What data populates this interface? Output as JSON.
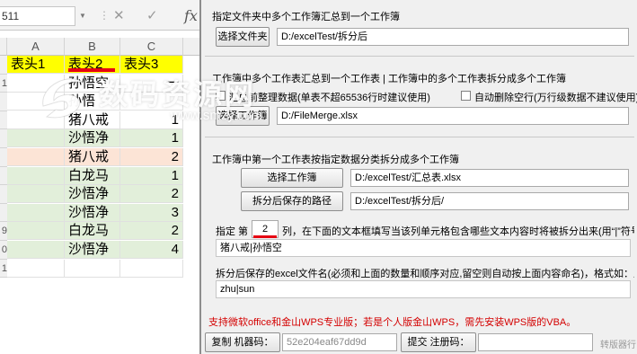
{
  "excel": {
    "name_box": "511",
    "formula_cancel": "✕",
    "formula_enter": "✓",
    "fx": "fx",
    "columns": [
      "A",
      "B",
      "C"
    ],
    "header_row": [
      "表头1",
      "表头2",
      "表头3"
    ],
    "rows": [
      {
        "num": "1",
        "b": "孙悟空",
        "c": "一"
      },
      {
        "num": "",
        "b": "孙悟",
        "c": ""
      },
      {
        "num": "",
        "b": "猪八戒",
        "c": "1"
      },
      {
        "num": "",
        "b": "沙悟净",
        "c": "1"
      },
      {
        "num": "",
        "b": "猪八戒",
        "c": "2"
      },
      {
        "num": "",
        "b": "白龙马",
        "c": "1"
      },
      {
        "num": "",
        "b": "沙悟净",
        "c": "2"
      },
      {
        "num": "",
        "b": "沙悟净",
        "c": "3"
      },
      {
        "num": "9",
        "b": "白龙马",
        "c": "2"
      },
      {
        "num": "0",
        "b": "沙悟净",
        "c": "4"
      },
      {
        "num": "1",
        "b": "",
        "c": ""
      }
    ],
    "colors": {
      "header_bg": "#ffff00",
      "green": "#e2efda",
      "orange": "#fce4d6"
    }
  },
  "dialog": {
    "section1": {
      "title": "指定文件夹中多个工作簿汇总到一个工作簿",
      "button": "选择文件夹",
      "path": "D:/excelTest/拆分后"
    },
    "section2": {
      "title": "工作簿中多个工作表汇总到一个工作表 | 工作簿中的多个工作表拆分成多个工作簿",
      "check1_label": "汇总前整理数据(单表不超65536行时建议使用)",
      "check2_label": "自动删除空行(万行级数据不建议使用)",
      "button": "选择工作簿",
      "path": "D:/FileMerge.xlsx"
    },
    "section3": {
      "title": "工作簿中第一个工作表按指定数据分类拆分成多个工作簿",
      "button1": "选择工作簿",
      "path1": "D:/excelTest/汇总表.xlsx",
      "button2": "拆分后保存的路径",
      "path2": "D:/excelTest/拆分后/",
      "col_prefix": "指定 第",
      "col_value": "2",
      "col_suffix": "列，在下面的文本框填写当该列单元格包含哪些文本内容时将被拆分出来(用“|”符号分开)，:",
      "filter_value": "猪八戒|孙悟空",
      "filename_label": "拆分后保存的excel文件名(必须和上面的数量和顺序对应,留空则自动按上面内容命名)，格式如：八戒报表|猴子",
      "filename_value": "zhu|sun"
    },
    "support_text": "支持微软office和金山WPS专业版；若是个人版金山WPS，需先安装WPS版的VBA。",
    "bottom": {
      "copy_button": "复制 机器码：",
      "machine_code": "52e204eaf67dd9d",
      "submit_button": "提交 注册码：",
      "status": "转版器行"
    }
  },
  "watermark": {
    "text": "数码资源网",
    "url": "www.smzy.com"
  }
}
